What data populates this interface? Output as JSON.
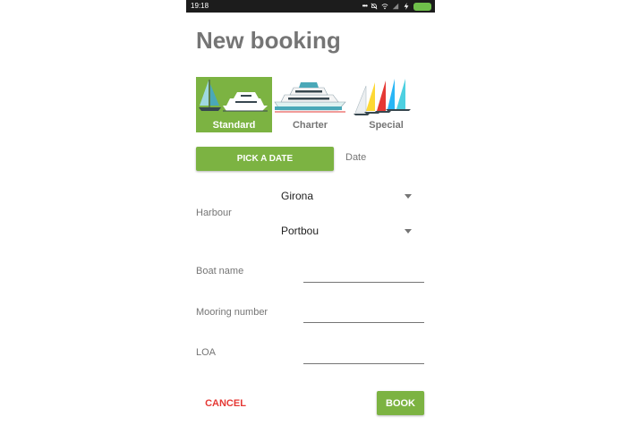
{
  "status_bar": {
    "time": "19:18"
  },
  "page": {
    "title": "New booking"
  },
  "boat_types": [
    {
      "label": "Standard",
      "selected": true,
      "icon": "sailboat-and-yacht-icon"
    },
    {
      "label": "Charter",
      "selected": false,
      "icon": "cruise-yacht-icon"
    },
    {
      "label": "Special",
      "selected": false,
      "icon": "regatta-sails-icon"
    }
  ],
  "date": {
    "button_label": "PICK A DATE",
    "value_label": "Date"
  },
  "harbour": {
    "label": "Harbour",
    "region_value": "Girona",
    "port_value": "Portbou"
  },
  "fields": {
    "boat_name_label": "Boat name",
    "mooring_number_label": "Mooring number",
    "loa_label": "LOA"
  },
  "actions": {
    "cancel_label": "CANCEL",
    "book_label": "BOOK"
  },
  "colors": {
    "accent": "#7cb342",
    "cancel": "#e53935",
    "text_muted": "#757575"
  }
}
